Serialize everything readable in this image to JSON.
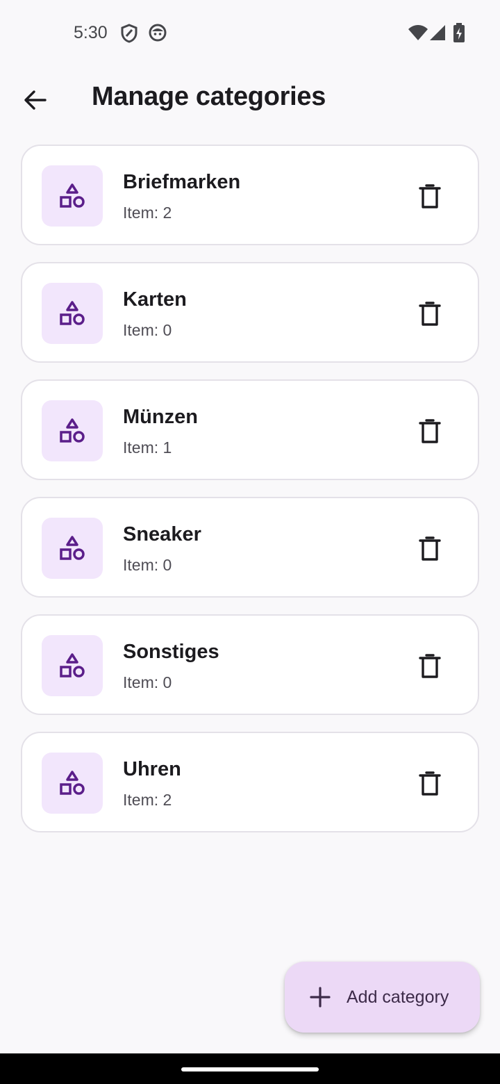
{
  "status_bar": {
    "time": "5:30",
    "icons": [
      "shield-icon",
      "android-face-icon",
      "wifi-icon",
      "signal-icon",
      "battery-charging-icon"
    ]
  },
  "app_bar": {
    "title": "Manage categories",
    "back_icon": "arrow-back-icon"
  },
  "categories": [
    {
      "name": "Briefmarken",
      "count": "Item: 2"
    },
    {
      "name": "Karten",
      "count": "Item: 0"
    },
    {
      "name": "Münzen",
      "count": "Item: 1"
    },
    {
      "name": "Sneaker",
      "count": "Item: 0"
    },
    {
      "name": "Sonstiges",
      "count": "Item: 0"
    },
    {
      "name": "Uhren",
      "count": "Item: 2"
    }
  ],
  "category_icon": "category-shapes-icon",
  "delete_icon": "trash-icon",
  "fab": {
    "label": "Add category",
    "icon": "plus-icon"
  },
  "colors": {
    "background": "#f9f8fa",
    "card": "#ffffff",
    "card_border": "#e4e1e8",
    "avatar_bg": "#f2e6fc",
    "accent": "#5b1e8a",
    "fab_bg": "#ecd9f6"
  }
}
